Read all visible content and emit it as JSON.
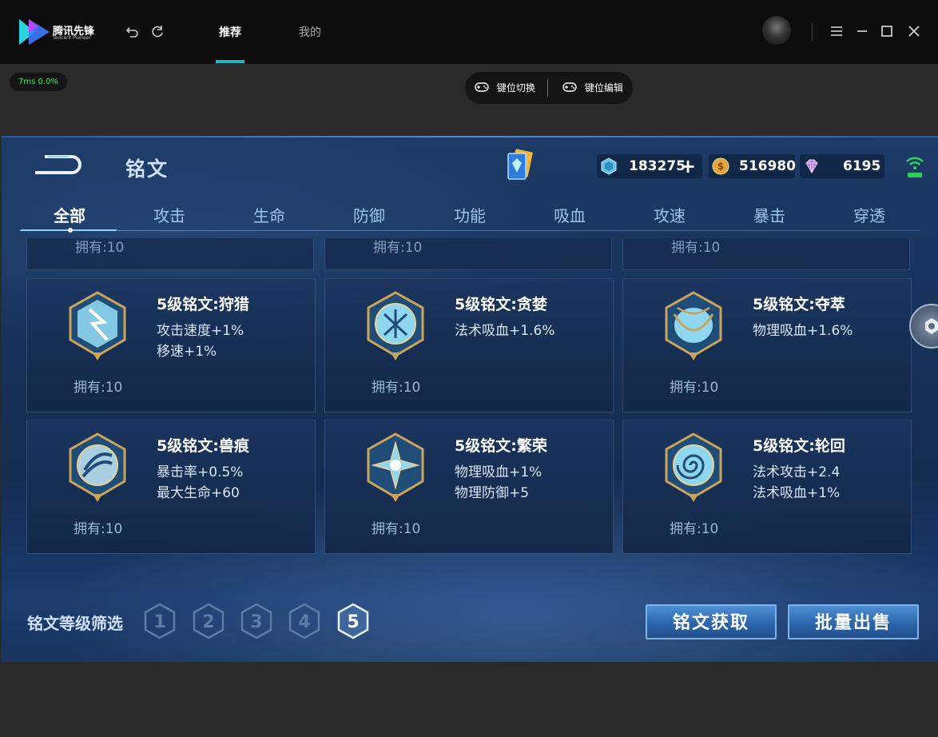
{
  "app": {
    "logo_text": "腾讯先锋",
    "logo_sub": "Tencent Pioneer",
    "tabs": [
      {
        "label": "推荐"
      },
      {
        "label": "我的"
      }
    ]
  },
  "status": {
    "text": "7ms  0.0%"
  },
  "controls": {
    "switch_label": "键位切换",
    "edit_label": "键位编辑"
  },
  "game": {
    "title": "铭文",
    "currencies": [
      {
        "name": "diamond-gem",
        "value": "183275",
        "color": "#5fc0e6"
      },
      {
        "name": "gold-coin",
        "value": "516980",
        "color": "#e4a53a"
      },
      {
        "name": "crystal",
        "value": "6195",
        "color": "#b37ee8"
      }
    ],
    "categories": [
      {
        "label": "全部"
      },
      {
        "label": "攻击"
      },
      {
        "label": "生命"
      },
      {
        "label": "防御"
      },
      {
        "label": "功能"
      },
      {
        "label": "吸血"
      },
      {
        "label": "攻速"
      },
      {
        "label": "暴击"
      },
      {
        "label": "穿透"
      }
    ],
    "partial_cards": [
      {
        "owned": "拥有:10"
      },
      {
        "owned": "拥有:10"
      },
      {
        "owned": "拥有:10"
      }
    ],
    "runes": [
      {
        "name": "5级铭文:狩猎",
        "stats": [
          "攻击速度+1%",
          "移速+1%"
        ],
        "owned": "拥有:10",
        "icon": "lightning-rune-icon"
      },
      {
        "name": "5级铭文:贪婪",
        "stats": [
          "法术吸血+1.6%"
        ],
        "owned": "拥有:10",
        "icon": "circle-rune-icon"
      },
      {
        "name": "5级铭文:夺萃",
        "stats": [
          "物理吸血+1.6%"
        ],
        "owned": "拥有:10",
        "icon": "drop-rune-icon"
      },
      {
        "name": "5级铭文:兽痕",
        "stats": [
          "暴击率+0.5%",
          "最大生命+60"
        ],
        "owned": "拥有:10",
        "icon": "claw-rune-icon"
      },
      {
        "name": "5级铭文:繁荣",
        "stats": [
          "物理吸血+1%",
          "物理防御+5"
        ],
        "owned": "拥有:10",
        "icon": "star-rune-icon"
      },
      {
        "name": "5级铭文:轮回",
        "stats": [
          "法术攻击+2.4",
          "法术吸血+1%"
        ],
        "owned": "拥有:10",
        "icon": "spiral-rune-icon"
      }
    ],
    "filter": {
      "label": "铭文等级筛选",
      "levels": [
        {
          "label": "1"
        },
        {
          "label": "2"
        },
        {
          "label": "3"
        },
        {
          "label": "4"
        },
        {
          "label": "5"
        }
      ]
    },
    "buttons": {
      "obtain": "铭文获取",
      "sell": "批量出售"
    }
  },
  "colors": {
    "accent": "#19b9c9",
    "ping_green": "#3ee06a",
    "wifi_green": "#2fd05a"
  }
}
